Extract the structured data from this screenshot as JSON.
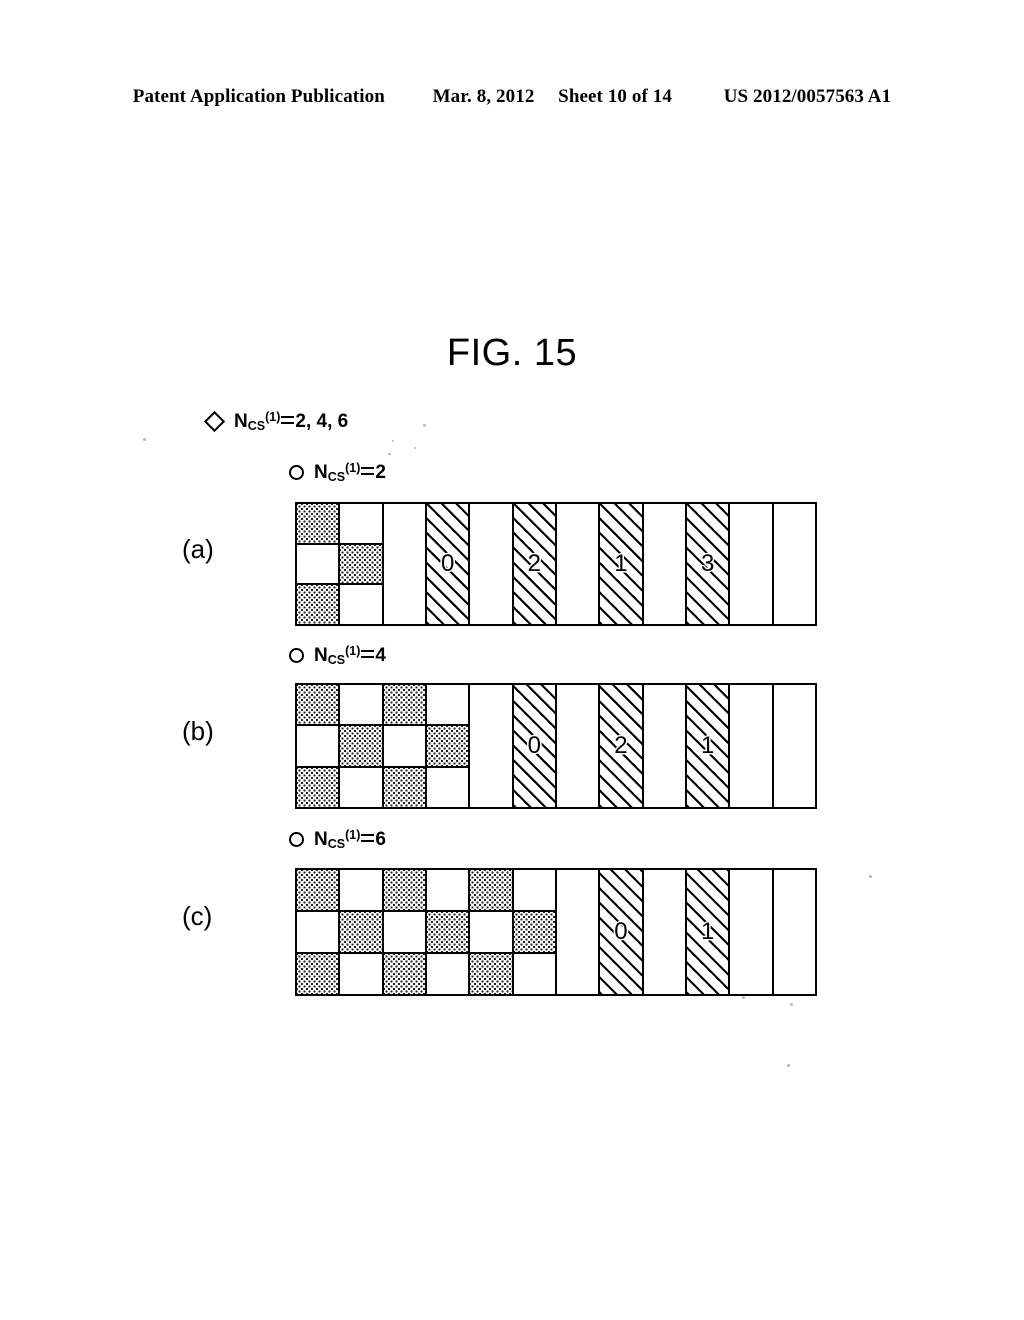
{
  "header": {
    "publication": "Patent Application Publication",
    "date": "Mar. 8, 2012",
    "sheet": "Sheet 10 of 14",
    "number": "US 2012/0057563 A1"
  },
  "figure": {
    "title": "FIG. 15"
  },
  "legend": [
    {
      "marker": "diamond-marker",
      "symbol": "N",
      "sub": "CS",
      "sup": "(1)",
      "value": "2, 4, 6",
      "text": "NCS(1)=2, 4, 6"
    }
  ],
  "panels": [
    {
      "label": "(a)",
      "legend": {
        "marker": "circle-marker",
        "symbol": "N",
        "sub": "CS",
        "sup": "(1)",
        "value": "2",
        "text": "NCS(1)=2"
      },
      "columns": [
        {
          "type": "checker",
          "cells": [
            "dot",
            "plain",
            "dot"
          ]
        },
        {
          "type": "checker",
          "cells": [
            "plain",
            "dot",
            "plain"
          ]
        },
        {
          "type": "plain",
          "label": ""
        },
        {
          "type": "hatch",
          "label": "0"
        },
        {
          "type": "plain",
          "label": ""
        },
        {
          "type": "hatch",
          "label": "2"
        },
        {
          "type": "plain",
          "label": ""
        },
        {
          "type": "hatch",
          "label": "1"
        },
        {
          "type": "plain",
          "label": ""
        },
        {
          "type": "hatch",
          "label": "3"
        },
        {
          "type": "plain",
          "label": ""
        },
        {
          "type": "plain",
          "label": ""
        }
      ]
    },
    {
      "label": "(b)",
      "legend": {
        "marker": "circle-marker",
        "symbol": "N",
        "sub": "CS",
        "sup": "(1)",
        "value": "4",
        "text": "NCS(1)=4"
      },
      "columns": [
        {
          "type": "checker",
          "cells": [
            "dot",
            "plain",
            "dot"
          ]
        },
        {
          "type": "checker",
          "cells": [
            "plain",
            "dot",
            "plain"
          ]
        },
        {
          "type": "checker",
          "cells": [
            "dot",
            "plain",
            "dot"
          ]
        },
        {
          "type": "checker",
          "cells": [
            "plain",
            "dot",
            "plain"
          ]
        },
        {
          "type": "plain",
          "label": ""
        },
        {
          "type": "hatch",
          "label": "0"
        },
        {
          "type": "plain",
          "label": ""
        },
        {
          "type": "hatch",
          "label": "2"
        },
        {
          "type": "plain",
          "label": ""
        },
        {
          "type": "hatch",
          "label": "1"
        },
        {
          "type": "plain",
          "label": ""
        },
        {
          "type": "plain",
          "label": ""
        }
      ]
    },
    {
      "label": "(c)",
      "legend": {
        "marker": "circle-marker",
        "symbol": "N",
        "sub": "CS",
        "sup": "(1)",
        "value": "6",
        "text": "NCS(1)=6"
      },
      "columns": [
        {
          "type": "checker",
          "cells": [
            "dot",
            "plain",
            "dot"
          ]
        },
        {
          "type": "checker",
          "cells": [
            "plain",
            "dot",
            "plain"
          ]
        },
        {
          "type": "checker",
          "cells": [
            "dot",
            "plain",
            "dot"
          ]
        },
        {
          "type": "checker",
          "cells": [
            "plain",
            "dot",
            "plain"
          ]
        },
        {
          "type": "checker",
          "cells": [
            "dot",
            "plain",
            "dot"
          ]
        },
        {
          "type": "checker",
          "cells": [
            "plain",
            "dot",
            "plain"
          ]
        },
        {
          "type": "plain",
          "label": ""
        },
        {
          "type": "hatch",
          "label": "0"
        },
        {
          "type": "plain",
          "label": ""
        },
        {
          "type": "hatch",
          "label": "1"
        },
        {
          "type": "plain",
          "label": ""
        },
        {
          "type": "plain",
          "label": ""
        }
      ]
    }
  ],
  "colors": {
    "ink": "#000000",
    "paper": "#ffffff",
    "dot_fill": "#1a1a1a"
  }
}
